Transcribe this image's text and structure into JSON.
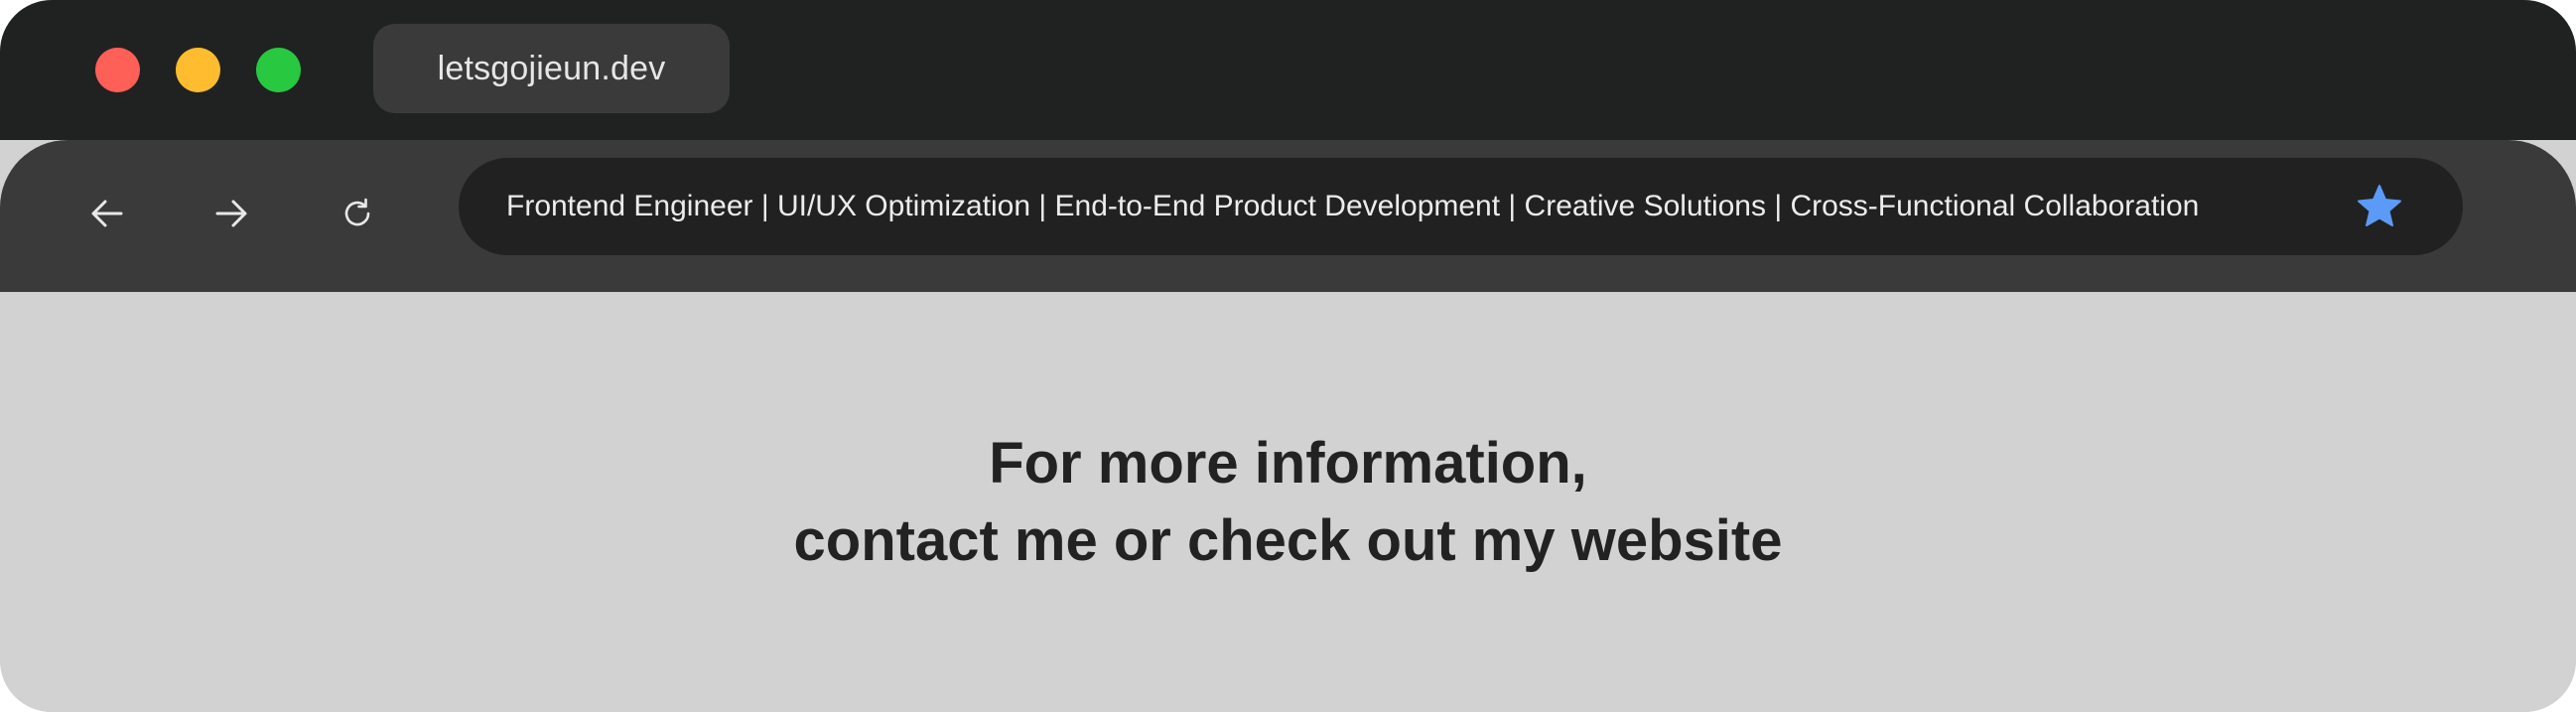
{
  "window": {
    "tab_title": "letsgojieun.dev",
    "traffic_lights": {
      "close_color": "#fe5f57",
      "minimize_color": "#febc2e",
      "maximize_color": "#28c840"
    }
  },
  "toolbar": {
    "back_icon": "arrow-left-icon",
    "forward_icon": "arrow-right-icon",
    "reload_icon": "reload-icon",
    "address_text": "Frontend Engineer | UI/UX Optimization | End-to-End Product Development | Creative Solutions | Cross-Functional Collaboration",
    "bookmark_icon": "star-icon",
    "bookmark_color": "#5b9bf7"
  },
  "content": {
    "line1": "For more information,",
    "line2": "contact me or check out my website"
  }
}
